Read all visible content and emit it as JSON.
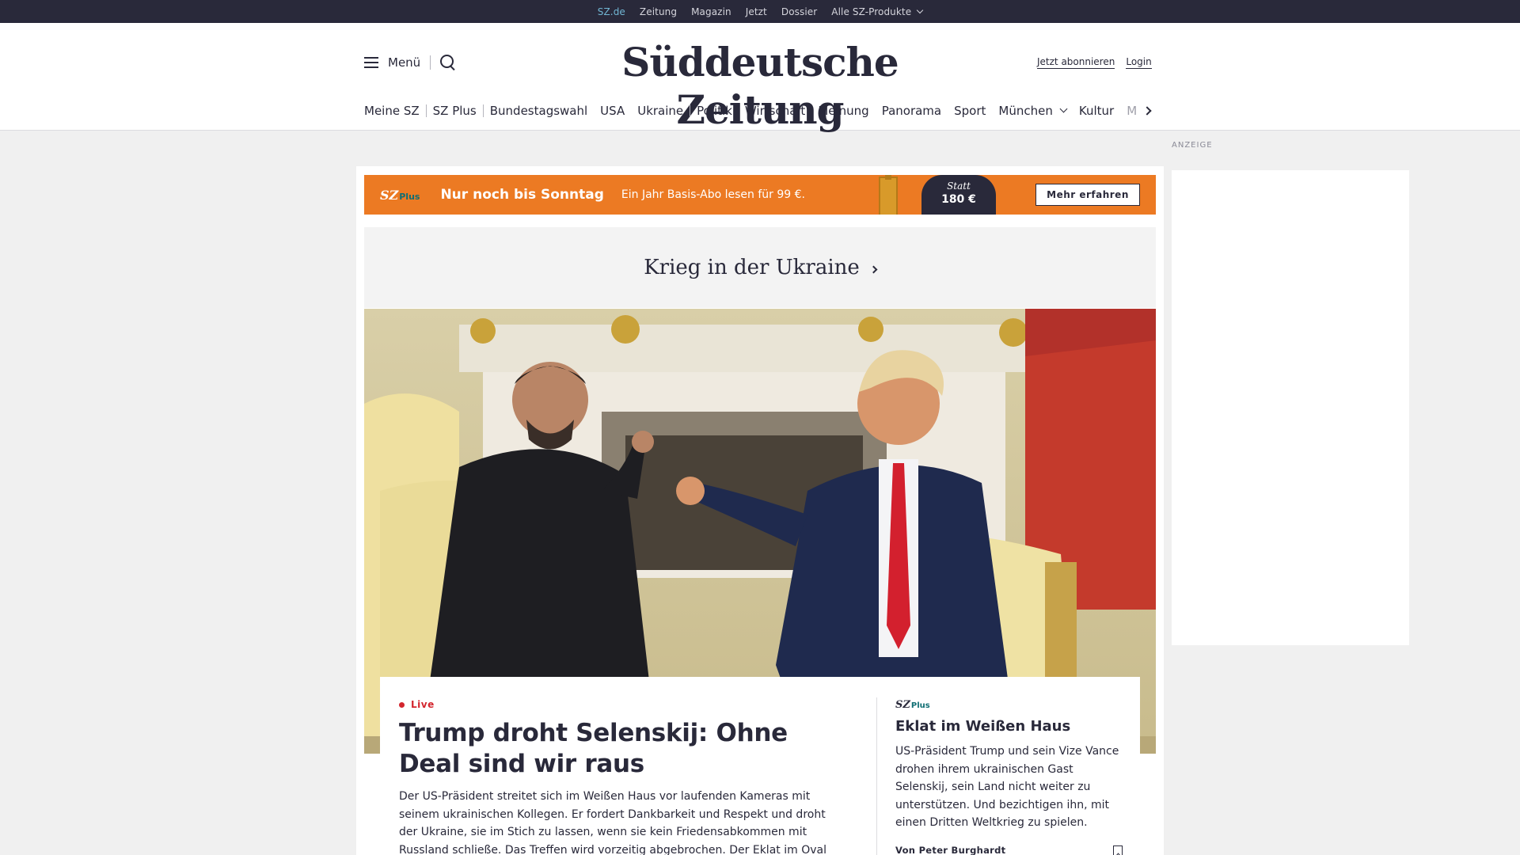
{
  "service_bar": {
    "items": [
      "SZ.de",
      "Zeitung",
      "Magazin",
      "Jetzt",
      "Dossier",
      "Alle SZ-Produkte"
    ]
  },
  "header": {
    "menu_label": "Menü",
    "logo_text": "Süddeutsche Zeitung",
    "subscribe_label": "Jetzt abonnieren",
    "login_label": "Login"
  },
  "main_nav": {
    "items": [
      "Meine SZ",
      "SZ Plus",
      "Bundestagswahl",
      "USA",
      "Ukraine",
      "Politik",
      "Wirtschaft",
      "Meinung",
      "Panorama",
      "Sport",
      "München",
      "Kultur",
      "M"
    ]
  },
  "ad_label": "ANZEIGE",
  "promo": {
    "logo": "SZ",
    "logo_plus": "Plus",
    "headline": "Nur noch bis Sonntag",
    "subline": "Ein Jahr Basis-Abo lesen für 99 €.",
    "price_prefix": "Statt",
    "price_amount": "180 €",
    "button_label": "Mehr erfahren",
    "color": "#ec7a23"
  },
  "topic": {
    "title": "Krieg in der Ukraine"
  },
  "lead_article": {
    "badge": "Live",
    "badge_color": "#d3262e",
    "headline": "Trump droht Selenskij: Ohne Deal sind wir raus",
    "teaser": "Der US-Präsident streitet sich im Weißen Haus vor laufenden Kameras mit seinem ukrainischen Kollegen. Er fordert Dankbarkeit und Respekt und droht der Ukraine, sie im Stich zu lassen, wenn sie kein Friedensabkommen mit Russland schließe. Das Treffen wird vorzeitig abgebrochen. Der Eklat im Oval Office im Video."
  },
  "side_article": {
    "label": "SZ",
    "label_plus": "Plus",
    "headline": "Eklat im Weißen Haus",
    "teaser": "US-Präsident Trump und sein Vize Vance drohen ihrem ukrainischen Gast Selenskij, sein Land nicht weiter zu unterstützen. Und bezichtigen ihn, mit einen Dritten Weltkrieg zu spielen.",
    "byline": "Von Peter Burghardt"
  },
  "icons": {
    "menu": "hamburger-icon",
    "search": "search-icon",
    "bookmark": "bookmark-icon",
    "live": "live-dot-icon"
  }
}
